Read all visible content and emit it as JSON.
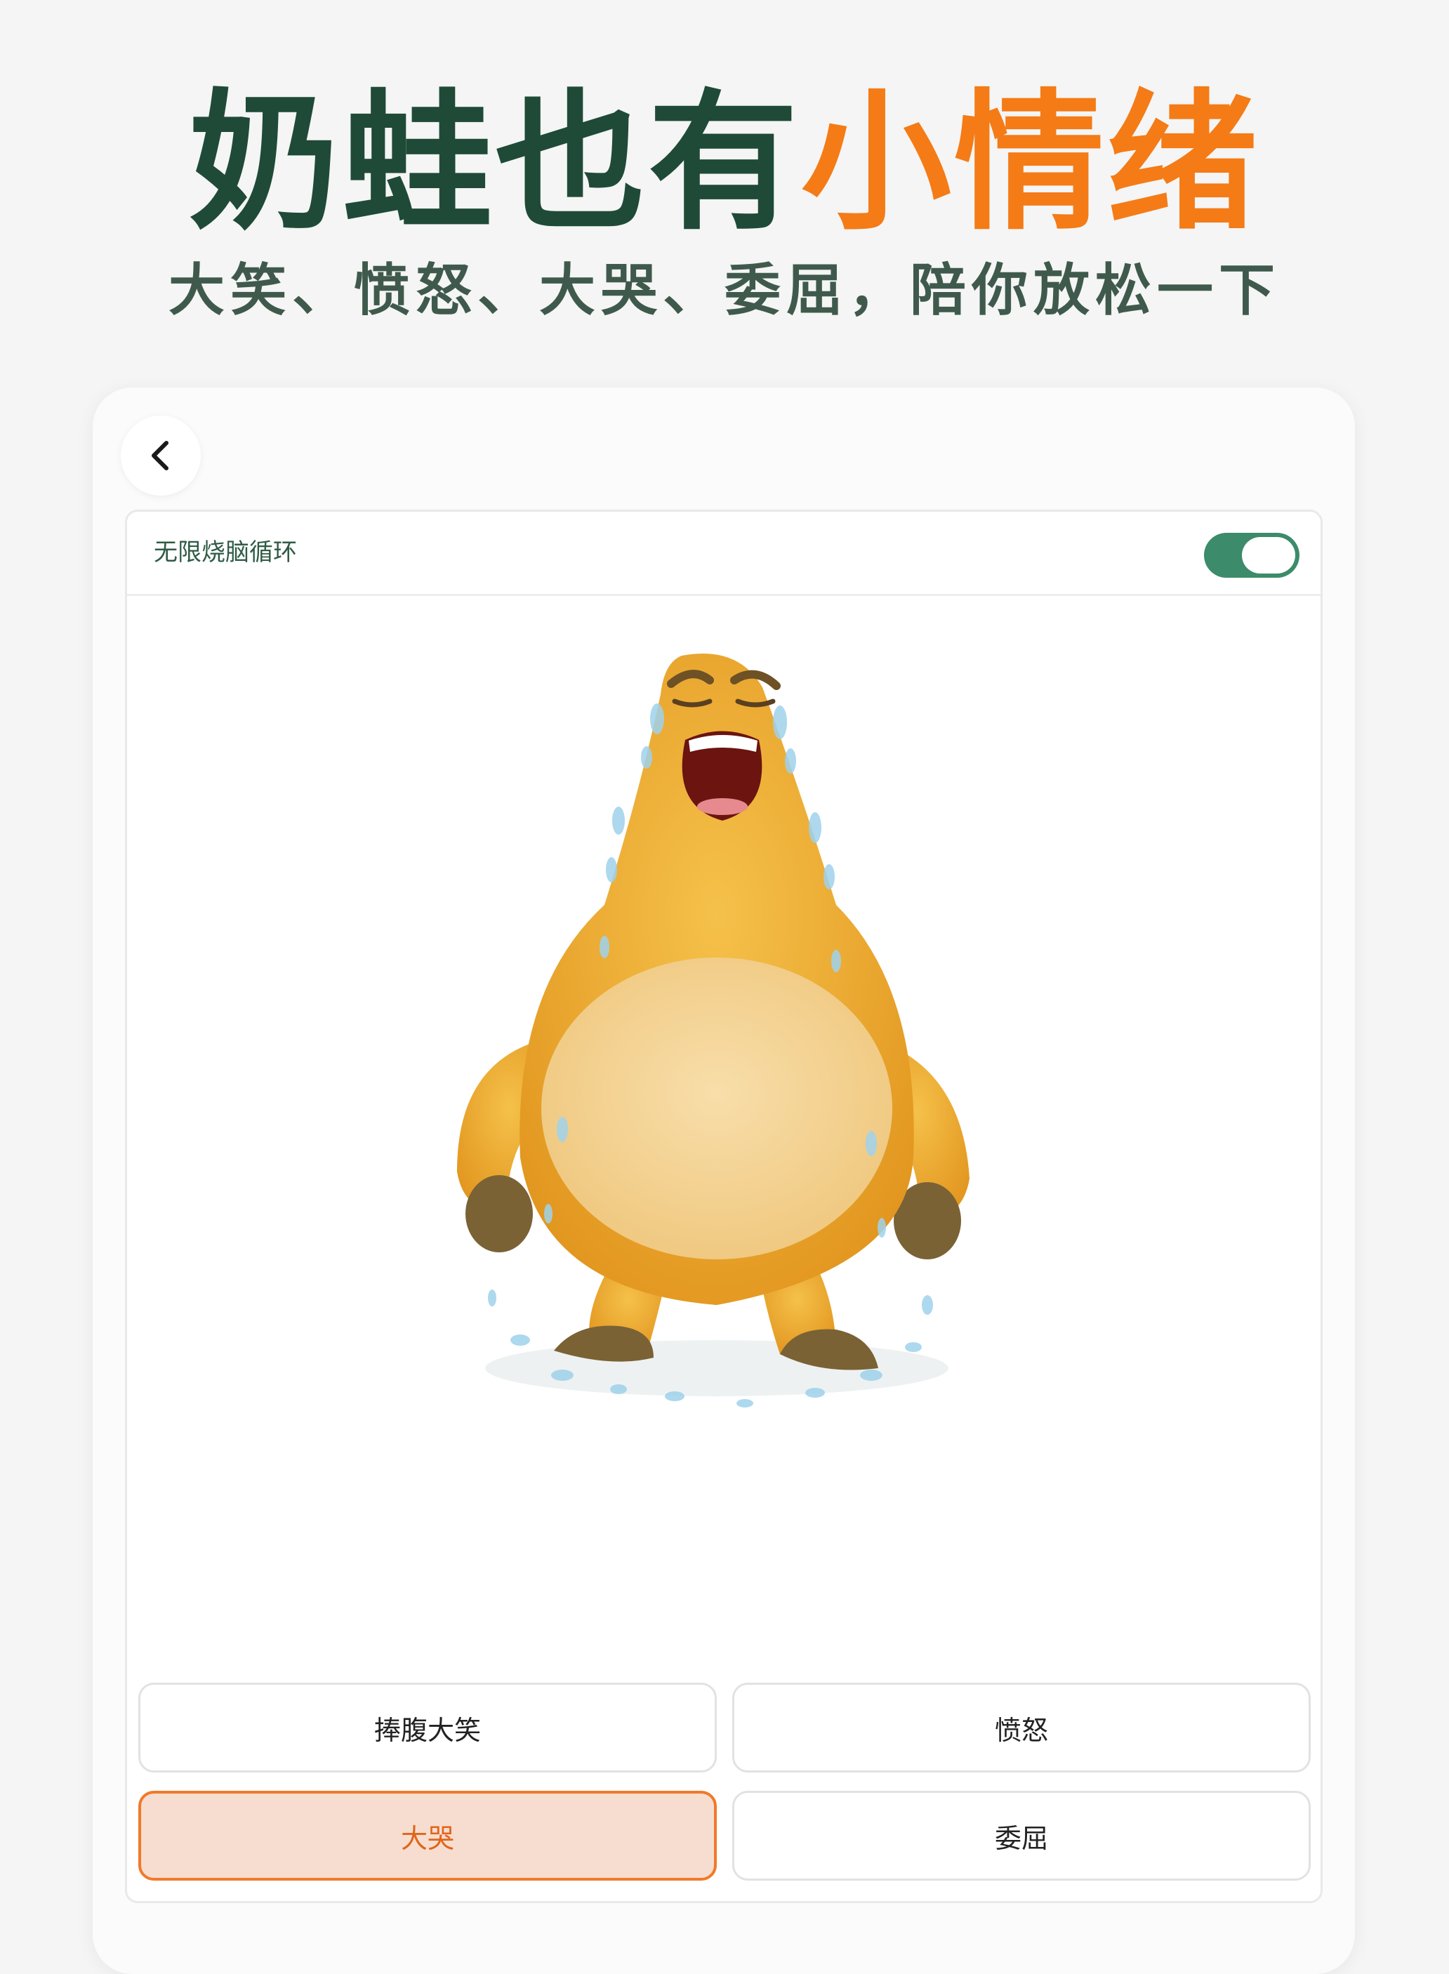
{
  "header": {
    "title_part1": "奶蛙也有",
    "title_part2": "小情绪",
    "subtitle": "大笑、愤怒、大哭、委屈，陪你放松一下"
  },
  "colors": {
    "title_dark": "#1f4a37",
    "title_accent": "#f47b16",
    "toggle_on": "#3c8b6a",
    "active_button_bg": "#f7ddd0",
    "active_button_border": "#f07a2a"
  },
  "toolbar": {
    "back_icon": "chevron-left-icon"
  },
  "loop_setting": {
    "label": "无限烧脑循环",
    "enabled": true
  },
  "character": {
    "icon": "crying-yellow-creature-illustration"
  },
  "moods": [
    {
      "label": "捧腹大笑",
      "selected": false
    },
    {
      "label": "愤怒",
      "selected": false
    },
    {
      "label": "大哭",
      "selected": true
    },
    {
      "label": "委屈",
      "selected": false
    }
  ]
}
